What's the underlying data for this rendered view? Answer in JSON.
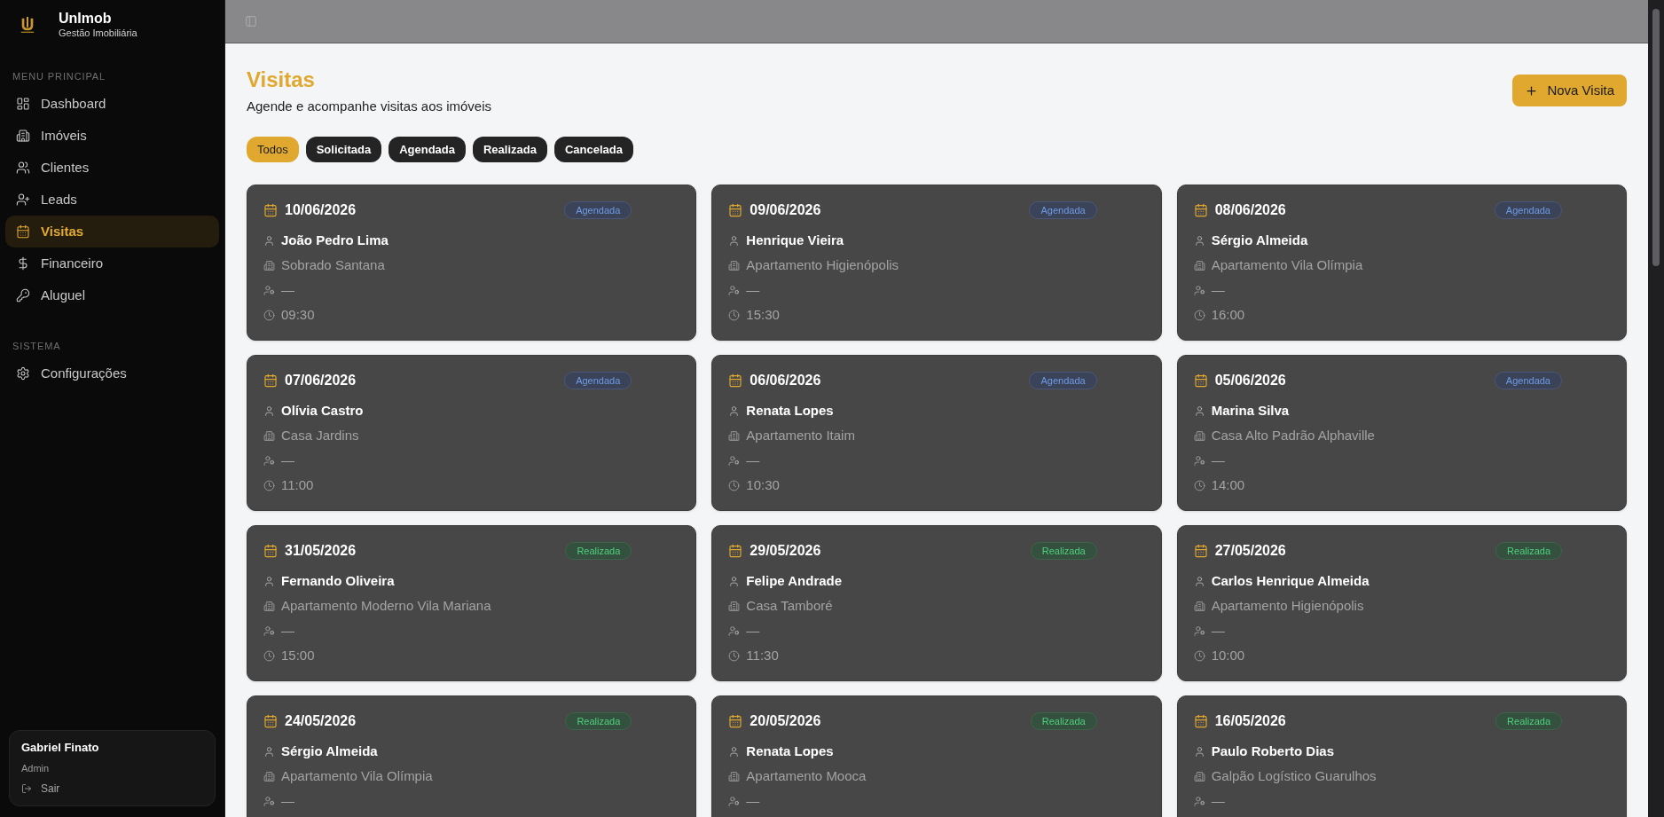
{
  "sidebar": {
    "brand": {
      "name": "UnImob",
      "tagline": "Gestão Imobiliária"
    },
    "sections": [
      {
        "title": "MENU PRINCIPAL",
        "items": [
          {
            "label": "Dashboard",
            "selected": false
          },
          {
            "label": "Imóveis",
            "selected": false
          },
          {
            "label": "Clientes",
            "selected": false
          },
          {
            "label": "Leads",
            "selected": false
          },
          {
            "label": "Visitas",
            "selected": true
          },
          {
            "label": "Financeiro",
            "selected": false
          },
          {
            "label": "Aluguel",
            "selected": false
          }
        ]
      },
      {
        "title": "SISTEMA",
        "items": [
          {
            "label": "Configurações",
            "selected": false
          }
        ]
      }
    ],
    "user": {
      "name": "Gabriel Finato",
      "role": "Admin",
      "logout": "Sair"
    }
  },
  "page": {
    "title": "Visitas",
    "subtitle": "Agende e acompanhe visitas aos imóveis",
    "new_button": "Nova Visita",
    "filters": [
      {
        "label": "Todos",
        "selected": true
      },
      {
        "label": "Solicitada",
        "selected": false
      },
      {
        "label": "Agendada",
        "selected": false
      },
      {
        "label": "Realizada",
        "selected": false
      },
      {
        "label": "Cancelada",
        "selected": false
      }
    ],
    "visits": [
      {
        "date": "10/06/2026",
        "status": {
          "label": "Agendada",
          "kind": "scheduled"
        },
        "client": "João Pedro Lima",
        "property": "Sobrado Santana",
        "agent": "—",
        "time": "09:30"
      },
      {
        "date": "09/06/2026",
        "status": {
          "label": "Agendada",
          "kind": "scheduled"
        },
        "client": "Henrique Vieira",
        "property": "Apartamento Higienópolis",
        "agent": "—",
        "time": "15:30"
      },
      {
        "date": "08/06/2026",
        "status": {
          "label": "Agendada",
          "kind": "scheduled"
        },
        "client": "Sérgio Almeida",
        "property": "Apartamento Vila Olímpia",
        "agent": "—",
        "time": "16:00"
      },
      {
        "date": "07/06/2026",
        "status": {
          "label": "Agendada",
          "kind": "scheduled"
        },
        "client": "Olívia Castro",
        "property": "Casa Jardins",
        "agent": "—",
        "time": "11:00"
      },
      {
        "date": "06/06/2026",
        "status": {
          "label": "Agendada",
          "kind": "scheduled"
        },
        "client": "Renata Lopes",
        "property": "Apartamento Itaim",
        "agent": "—",
        "time": "10:30"
      },
      {
        "date": "05/06/2026",
        "status": {
          "label": "Agendada",
          "kind": "scheduled"
        },
        "client": "Marina Silva",
        "property": "Casa Alto Padrão Alphaville",
        "agent": "—",
        "time": "14:00"
      },
      {
        "date": "31/05/2026",
        "status": {
          "label": "Realizada",
          "kind": "completed"
        },
        "client": "Fernando Oliveira",
        "property": "Apartamento Moderno Vila Mariana",
        "agent": "—",
        "time": "15:00"
      },
      {
        "date": "29/05/2026",
        "status": {
          "label": "Realizada",
          "kind": "completed"
        },
        "client": "Felipe Andrade",
        "property": "Casa Tamboré",
        "agent": "—",
        "time": "11:30"
      },
      {
        "date": "27/05/2026",
        "status": {
          "label": "Realizada",
          "kind": "completed"
        },
        "client": "Carlos Henrique Almeida",
        "property": "Apartamento Higienópolis",
        "agent": "—",
        "time": "10:00"
      },
      {
        "date": "24/05/2026",
        "status": {
          "label": "Realizada",
          "kind": "completed"
        },
        "client": "Sérgio Almeida",
        "property": "Apartamento Vila Olímpia",
        "agent": "—"
      },
      {
        "date": "20/05/2026",
        "status": {
          "label": "Realizada",
          "kind": "completed"
        },
        "client": "Renata Lopes",
        "property": "Apartamento Mooca",
        "agent": "—"
      },
      {
        "date": "16/05/2026",
        "status": {
          "label": "Realizada",
          "kind": "completed"
        },
        "client": "Paulo Roberto Dias",
        "property": "Galpão Logístico Guarulhos",
        "agent": "—"
      }
    ]
  }
}
